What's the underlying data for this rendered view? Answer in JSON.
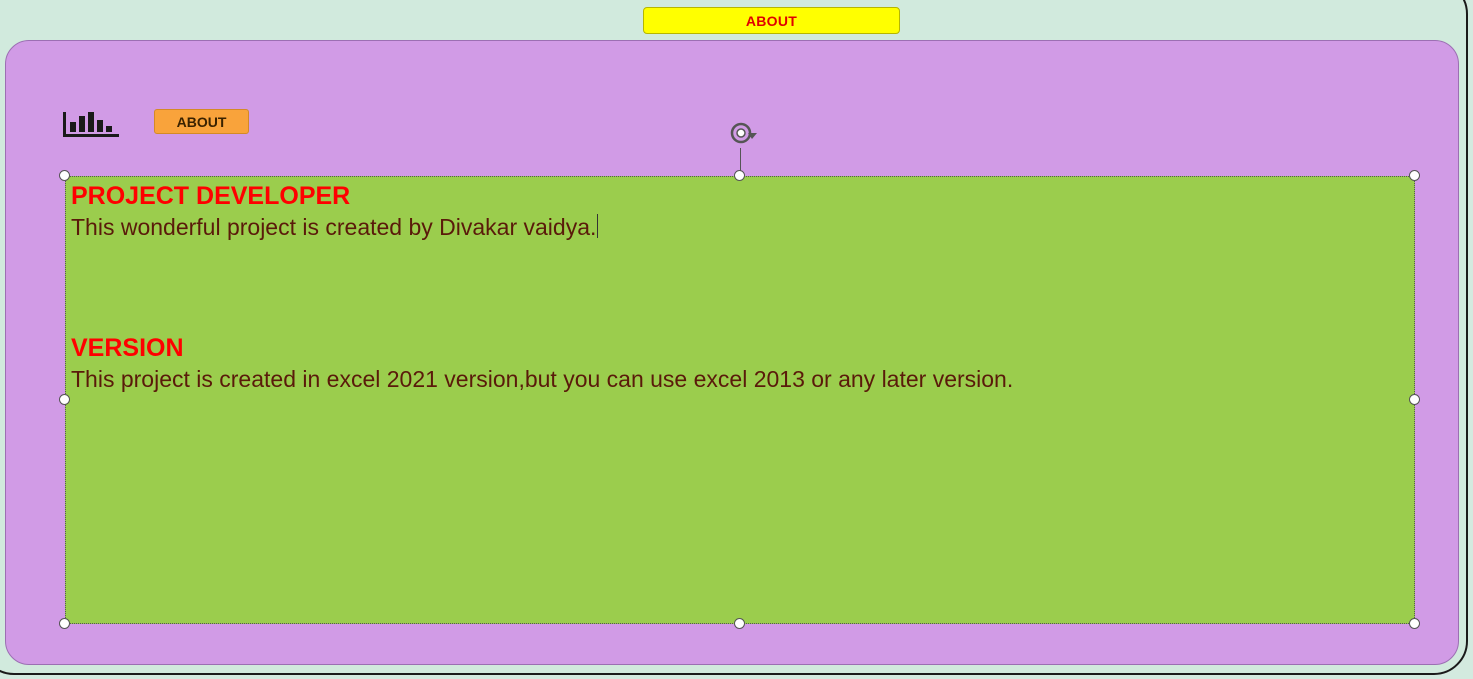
{
  "toolbar": {
    "top_about_label": "ABOUT",
    "small_about_label": "ABOUT"
  },
  "textbox": {
    "developer_heading": "PROJECT DEVELOPER",
    "developer_text": "This wonderful project is created by Divakar vaidya.",
    "version_heading": "VERSION",
    "version_text": "This project is created in excel 2021 version,but you can use excel 2013 or any later version."
  },
  "icons": {
    "chart": "bar-chart-icon",
    "rotate": "rotate-handle-icon"
  },
  "colors": {
    "background": "#d3eadf",
    "panel": "#d19be6",
    "textbox": "#9bcd4d",
    "top_button": "#ffff00",
    "small_button": "#f9a33b",
    "heading": "#ff0000",
    "body_text": "#5a1a0a"
  }
}
